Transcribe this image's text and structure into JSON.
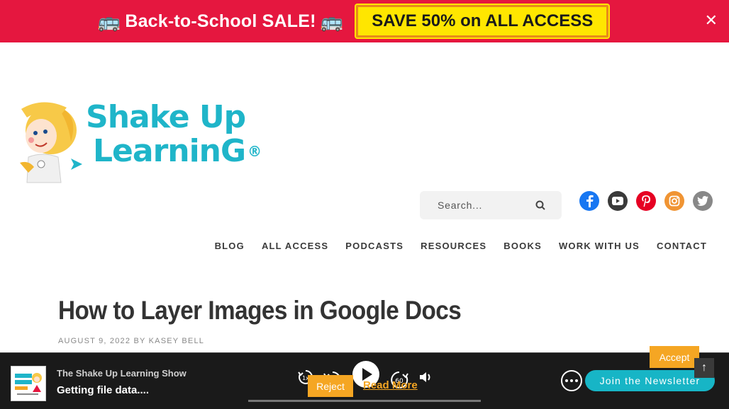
{
  "promo": {
    "bus_left": "🚌",
    "text": "Back-to-School SALE!",
    "bus_right": "🚌",
    "cta": "SAVE 50% on ALL ACCESS",
    "close": "✕",
    "bg_color": "#e5173f",
    "cta_color": "#ffe600"
  },
  "logo": {
    "line1": "Shake Up",
    "line2": "LearninG",
    "reg": "®"
  },
  "search": {
    "placeholder": "Search..."
  },
  "socials": [
    {
      "icon": "facebook-icon",
      "color": "#1877f2"
    },
    {
      "icon": "youtube-icon",
      "color": "#ff0000"
    },
    {
      "icon": "pinterest-icon",
      "color": "#e60023"
    },
    {
      "icon": "instagram-icon",
      "color": "#f09433"
    },
    {
      "icon": "twitter-icon",
      "color": "#888888"
    }
  ],
  "nav": [
    "BLOG",
    "ALL ACCESS",
    "PODCASTS",
    "RESOURCES",
    "BOOKS",
    "WORK WITH US",
    "CONTACT"
  ],
  "post": {
    "title": "How to Layer Images in Google Docs",
    "date": "AUGUST 9, 2022",
    "by": "BY",
    "author": "KASEY BELL"
  },
  "player": {
    "show_name": "The Shake Up Learning Show",
    "episode_title": "Getting file data....",
    "rewind_label": "10",
    "speed_label": "1x",
    "forward_label": "60",
    "newsletter": "Join the Newsletter"
  },
  "cookie": {
    "accept": "Accept",
    "reject": "Reject",
    "read_more": "Read More"
  },
  "to_top": "↑"
}
